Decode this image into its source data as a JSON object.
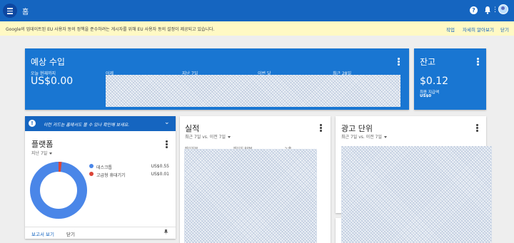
{
  "topbar": {
    "home_label": "홈",
    "help_icon": "help-icon",
    "notifications_icon": "bell-icon",
    "apps_icon": "grid-icon",
    "avatar_icon": "avatar"
  },
  "notice": {
    "message": "Google의 업데이트된 EU 사용자 동의 정책을 준수하려는 게시자를 위해 EU 사용자 동의 설정이 제공되고 있습니다.",
    "links": [
      "작업",
      "자세히 알아보기",
      "닫기"
    ]
  },
  "estimated": {
    "title": "예상 수입",
    "periods": [
      {
        "label": "오늘 현재까지",
        "value": "US$0.00"
      },
      {
        "label": "어제"
      },
      {
        "label": "지난 7일"
      },
      {
        "label": "이번 달"
      },
      {
        "label": "최근 28일"
      }
    ]
  },
  "balance": {
    "title": "잔고",
    "value": "$0.12",
    "last_payment_label": "최종 지급액",
    "last_payment_value": "US$0"
  },
  "platform": {
    "tip_text": "이런 카드는 홈에서도 볼 수 있나 확인해 보세요.",
    "title": "플랫폼",
    "range": "지난 7일",
    "legend": [
      {
        "label": "데스크톱",
        "value": "US$0.55",
        "color": "#4a86e8"
      },
      {
        "label": "고급형 휴대기기",
        "value": "US$0.01",
        "color": "#db4437"
      }
    ],
    "donut": {
      "desktop": 0.55,
      "high_end_mobile": 0.01
    },
    "footer": {
      "report": "보고서 보기",
      "close": "닫기"
    }
  },
  "performance": {
    "title": "실적",
    "range": "최근 7일 vs. 이전 7일",
    "col_headers": [
      "페이지뷰",
      "페이지 RPM",
      "노출"
    ]
  },
  "ad_units": {
    "title": "광고 단위",
    "range": "최근 7일 vs. 이전 7일"
  }
}
